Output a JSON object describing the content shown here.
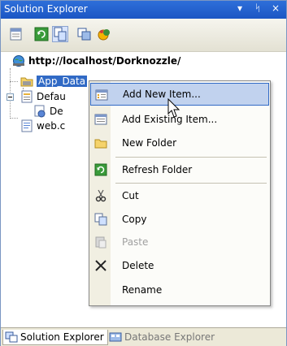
{
  "titlebar": {
    "title": "Solution Explorer",
    "pin": "↓ ̸",
    "close": "×"
  },
  "toolbar": {
    "buttons": [
      "properties-icon",
      "refresh-icon",
      "nest-related-files-icon",
      "copy-website-icon",
      "asp-net-config-icon"
    ]
  },
  "tree": {
    "root": "http://localhost/Dorknozzle/",
    "items": [
      {
        "label": "App_Data"
      },
      {
        "label": "Defau"
      },
      {
        "label": "De"
      },
      {
        "label": "web.c"
      }
    ]
  },
  "context_menu": {
    "items": [
      {
        "label": "Add New Item...",
        "icon": "add-new-item-icon",
        "hover": true
      },
      {
        "label": "Add Existing Item...",
        "icon": "add-existing-item-icon"
      },
      {
        "label": "New Folder",
        "icon": "new-folder-icon"
      },
      {
        "label": "Refresh Folder",
        "icon": "refresh-folder-icon"
      },
      {
        "label": "Cut",
        "icon": "cut-icon"
      },
      {
        "label": "Copy",
        "icon": "copy-icon"
      },
      {
        "label": "Paste",
        "icon": "paste-icon",
        "disabled": true
      },
      {
        "label": "Delete",
        "icon": "delete-icon"
      },
      {
        "label": "Rename",
        "icon": ""
      }
    ]
  },
  "bottom_tabs": [
    {
      "label": "Solution Explorer",
      "active": true
    },
    {
      "label": "Database Explorer",
      "active": false
    }
  ],
  "colors": {
    "titlebar": "#1b56c4",
    "selection": "#316ac5",
    "menu_hover": "#c1d2ee"
  }
}
